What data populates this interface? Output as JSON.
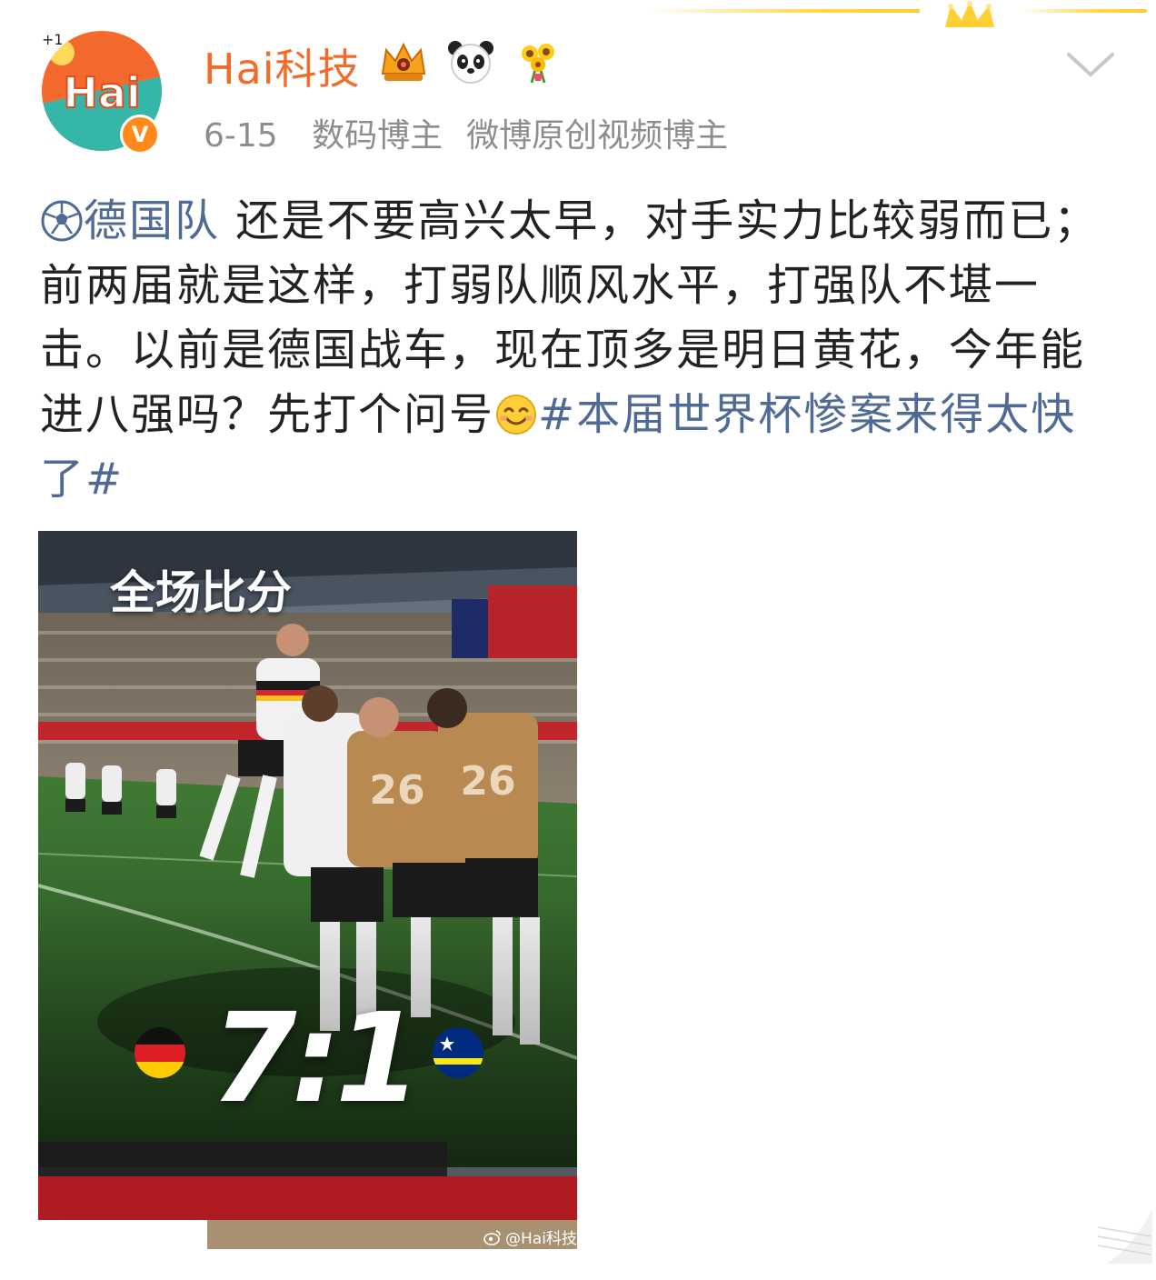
{
  "header": {
    "username": "Hai科技",
    "avatar_text": "Hai",
    "avatar_badge": "+1",
    "verified_badge": "V",
    "date": "6-15",
    "tag_1": "数码博主",
    "tag_2": "微博原创视频博主"
  },
  "post": {
    "topic": "德国队",
    "text_1": " 还是不要高兴太早，对手实力比较弱而已；前两届就是这样，打弱队顺风水平，打强队不堪一击。以前是德国战车，现在顶多是明日黄花，今年能进八强吗？先打个问号",
    "hashtag": "#本届世界杯惨案来得太快了#"
  },
  "image": {
    "title": "全场比分",
    "score": "7:1",
    "watermark": "@Hai科技"
  },
  "colors": {
    "username": "#f26b2a",
    "link": "#4f6b95",
    "meta": "#8d8d8d"
  },
  "icons": [
    "soccer-ball-icon",
    "crown-badge-icon",
    "panda-icon",
    "sunflower-icon",
    "smile-emoji-icon",
    "chevron-down-icon",
    "weibo-logo-icon"
  ]
}
